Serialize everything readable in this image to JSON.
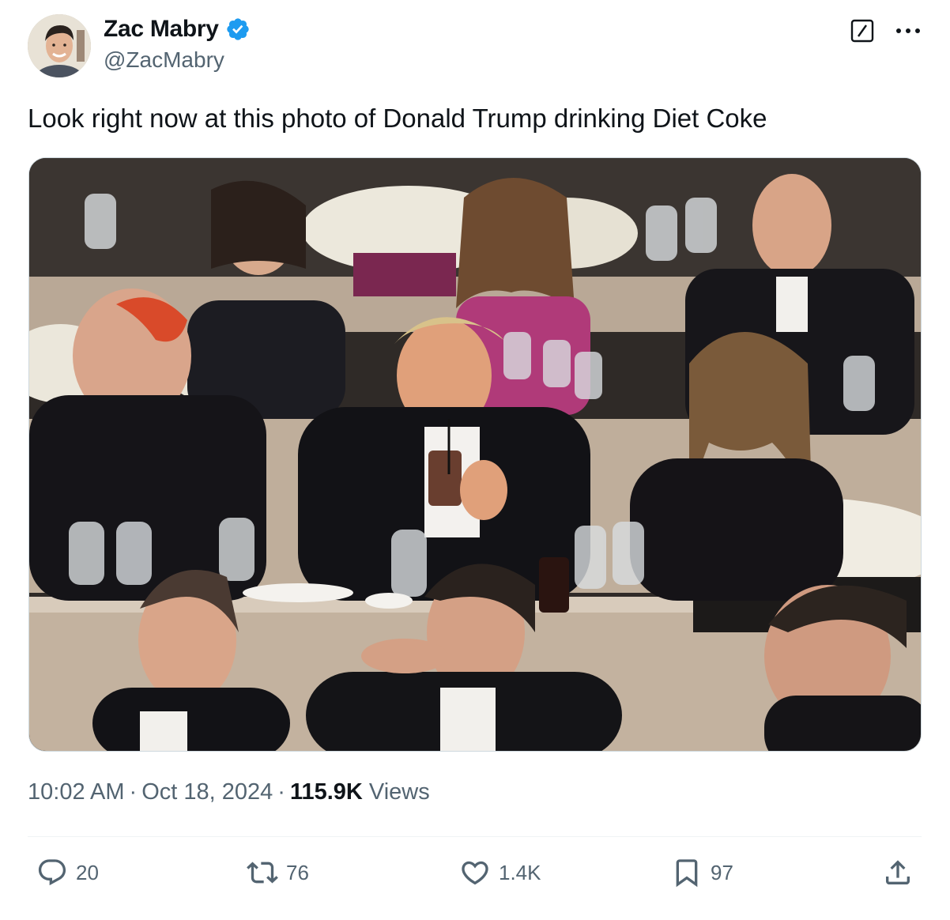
{
  "author": {
    "display_name": "Zac Mabry",
    "handle": "@ZacMabry",
    "verified": true
  },
  "header_icons": [
    "grok-icon",
    "more-icon"
  ],
  "tweet": {
    "text": "Look right now at this photo of Donald Trump drinking Diet Coke"
  },
  "meta": {
    "time": "10:02 AM",
    "separator": "·",
    "date": "Oct 18, 2024",
    "views_count": "115.9K",
    "views_label": "Views"
  },
  "actions": {
    "replies": "20",
    "reposts": "76",
    "likes": "1.4K",
    "bookmarks": "97"
  },
  "colors": {
    "verified": "#1d9bf0",
    "secondary_text": "#536471",
    "primary_text": "#0f1419",
    "divider": "#eff3f4"
  }
}
